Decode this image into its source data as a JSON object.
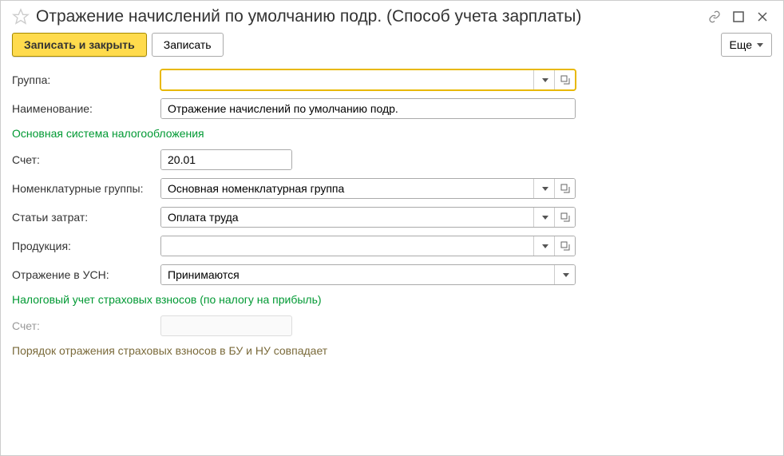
{
  "header": {
    "title": "Отражение начислений по умолчанию подр. (Способ учета зарплаты)"
  },
  "toolbar": {
    "save_close": "Записать и закрыть",
    "save": "Записать",
    "more": "Еще"
  },
  "labels": {
    "group": "Группа:",
    "name": "Наименование:",
    "account": "Счет:",
    "nomenclature": "Номенклатурные группы:",
    "cost_items": "Статьи затрат:",
    "products": "Продукция:",
    "usn": "Отражение в УСН:",
    "account2": "Счет:"
  },
  "values": {
    "group": "",
    "name": "Отражение начислений по умолчанию подр.",
    "account": "20.01",
    "nomenclature": "Основная номенклатурная группа",
    "cost_items": "Оплата труда",
    "products": "",
    "usn": "Принимаются",
    "account2": ""
  },
  "sections": {
    "main": "Основная система налогообложения",
    "tax": "Налоговый учет страховых взносов (по налогу на прибыль)"
  },
  "note": "Порядок отражения страховых взносов в БУ и НУ совпадает"
}
